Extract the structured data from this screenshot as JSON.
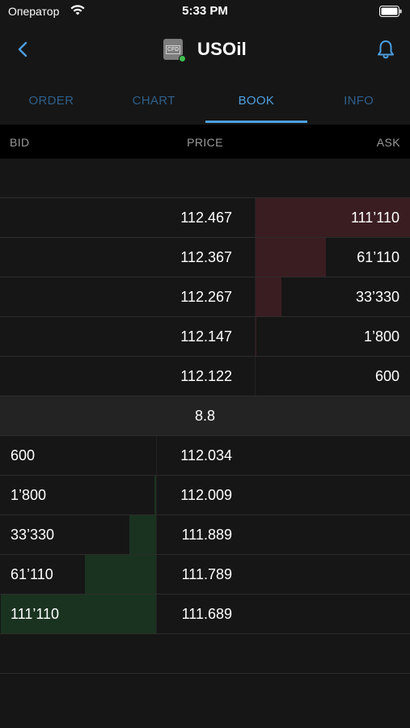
{
  "status_bar": {
    "carrier": "Оператор",
    "time": "5:33 PM"
  },
  "nav": {
    "title": "USOil",
    "instrument_badge": "CFD",
    "online_color": "#3fbf4f"
  },
  "tabs": [
    {
      "label": "ORDER",
      "active": false
    },
    {
      "label": "CHART",
      "active": false
    },
    {
      "label": "BOOK",
      "active": true
    },
    {
      "label": "INFO",
      "active": false
    }
  ],
  "columns": {
    "bid": "BID",
    "price": "PRICE",
    "ask": "ASK"
  },
  "asks": [
    {
      "price": "112.467",
      "size": "111’110",
      "depth": 1.0
    },
    {
      "price": "112.367",
      "size": "61’110",
      "depth": 0.46
    },
    {
      "price": "112.267",
      "size": "33’330",
      "depth": 0.17
    },
    {
      "price": "112.147",
      "size": "1’800",
      "depth": 0.01
    },
    {
      "price": "112.122",
      "size": "600",
      "depth": 0.0
    }
  ],
  "spread": "8.8",
  "bids": [
    {
      "price": "112.034",
      "size": "600",
      "depth": 0.0
    },
    {
      "price": "112.009",
      "size": "1’800",
      "depth": 0.01
    },
    {
      "price": "111.889",
      "size": "33’330",
      "depth": 0.17
    },
    {
      "price": "111.789",
      "size": "61’110",
      "depth": 0.46
    },
    {
      "price": "111.689",
      "size": "111’110",
      "depth": 1.0
    }
  ],
  "colors": {
    "ask_depth": "#3a1d21",
    "bid_depth": "#1a3320",
    "accent": "#4d9fe0"
  }
}
